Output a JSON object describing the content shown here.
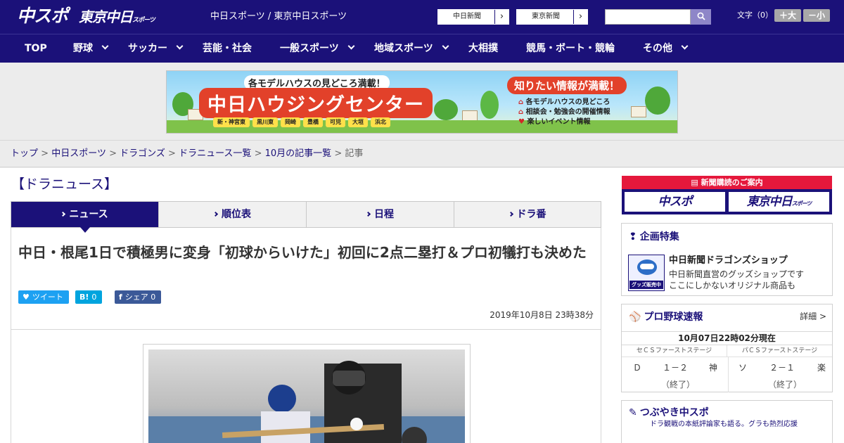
{
  "header": {
    "logo_primary": "中スポ",
    "logo_secondary": "東京中日",
    "logo_secondary_small": "スポーツ",
    "site_name": "中日スポーツ / 東京中日スポーツ",
    "paper_links": [
      {
        "label": "中日新聞",
        "arrow": "›"
      },
      {
        "label": "東京新聞",
        "arrow": "›"
      }
    ],
    "search": {
      "value": "",
      "placeholder": ""
    },
    "font_size_label": "文字（0）",
    "font_larger": "＋大",
    "font_smaller": "－小"
  },
  "nav": [
    {
      "label": "TOP",
      "dropdown": false
    },
    {
      "label": "野球",
      "dropdown": true
    },
    {
      "label": "サッカー",
      "dropdown": true
    },
    {
      "label": "芸能・社会",
      "dropdown": false
    },
    {
      "label": "一般スポーツ",
      "dropdown": true
    },
    {
      "label": "地域スポーツ",
      "dropdown": true
    },
    {
      "label": "大相撲",
      "dropdown": false
    },
    {
      "label": "競馬・ボート・競輪",
      "dropdown": false
    },
    {
      "label": "その他",
      "dropdown": true
    }
  ],
  "banner": {
    "top_text": "各モデルハウスの見どころ満載！",
    "main_text": "中日ハウジングセンター",
    "bubble_text": "知りたい情報が満載！",
    "info_lines": [
      "各モデルハウスの見どころ",
      "相談会・勉強会の開催情報",
      "楽しいイベント情報"
    ],
    "cities": [
      "新・神宮東",
      "黒川東",
      "岡崎",
      "豊橋",
      "可児",
      "大垣",
      "浜北"
    ]
  },
  "breadcrumb": {
    "items": [
      "トップ",
      "中日スポーツ",
      "ドラゴンズ",
      "ドラニュース一覧",
      "10月の記事一覧"
    ],
    "current": "記事",
    "separator": ">"
  },
  "section_title": "【ドラニュース】",
  "tabs": [
    {
      "label": "ニュース",
      "active": true
    },
    {
      "label": "順位表",
      "active": false
    },
    {
      "label": "日程",
      "active": false
    },
    {
      "label": "ドラ番",
      "active": false
    }
  ],
  "article": {
    "headline": "中日・根尾1日で積極男に変身「初球からいけた」初回に2点二塁打＆プロ初犠打も決めた",
    "share": [
      {
        "icon": "twitter-bird",
        "label": "ツイート",
        "count": "",
        "color": "#1da1f2"
      },
      {
        "icon": "hatena-b",
        "label": "B!",
        "count": "0",
        "color": "#00a4de"
      },
      {
        "icon": "facebook-f",
        "label": "シェア",
        "count": "0",
        "color": "#3b5998"
      }
    ],
    "date": "2019年10月8日 23時38分"
  },
  "sidebar": {
    "subscription": {
      "header": "新聞購読のご案内",
      "buttons": [
        "中スポ",
        "東京中日"
      ],
      "button2_small": "スポーツ"
    },
    "special": {
      "title": "企画特集",
      "badge": "グッズ販売中",
      "item_title": "中日新聞ドラゴンズショップ",
      "item_desc": [
        "中日新聞直営のグッズショップです",
        "ここにしかないオリジナル商品も"
      ]
    },
    "scores": {
      "title": "プロ野球速報",
      "detail": "詳細 >",
      "updated": "10月07日22時02分現在",
      "games": [
        {
          "stage": "セＣＳファーストステージ",
          "home": "Ｄ",
          "score": "１－２",
          "away": "神",
          "status": "（終了）"
        },
        {
          "stage": "パＣＳファーストステージ",
          "home": "ソ",
          "score": "２－１",
          "away": "楽",
          "status": "（終了）"
        }
      ]
    },
    "tweets": {
      "title": "つぶやき中スポ",
      "subtitle": "ドラ観戦の本紙評論家も語る。グラも熱烈応援"
    }
  },
  "colors": {
    "brand_navy": "#1b1179",
    "subscription_red": "#e5183c",
    "page_bg": "#ececec"
  }
}
